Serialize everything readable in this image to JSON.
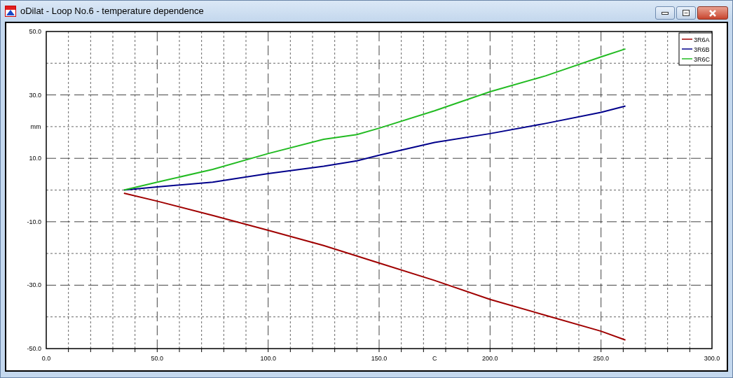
{
  "window": {
    "title": "oDilat - Loop No.6 - temperature dependence"
  },
  "chart": {
    "chart_data": {
      "type": "line",
      "xlabel": "C",
      "ylabel": "mm",
      "x": [
        35,
        50,
        75,
        100,
        125,
        140,
        150,
        175,
        200,
        225,
        250,
        261
      ],
      "series": [
        {
          "name": "3R6A",
          "color": "#a00000",
          "values": [
            -1,
            -3.5,
            -8,
            -12.7,
            -17.5,
            -20.8,
            -23,
            -28.5,
            -34.5,
            -39.5,
            -44.5,
            -47.3
          ]
        },
        {
          "name": "3R6B",
          "color": "#00008b",
          "values": [
            0,
            1,
            2.5,
            5.2,
            7.5,
            9.2,
            11,
            15,
            17.8,
            21,
            24.5,
            26.5
          ]
        },
        {
          "name": "3R6C",
          "color": "#22bb22",
          "values": [
            0,
            2.5,
            6.5,
            11.5,
            16,
            17.5,
            19.5,
            25,
            31,
            36,
            42,
            44.5
          ]
        }
      ],
      "grid": true,
      "legend": true,
      "xlim": [
        0,
        300
      ],
      "ylim": [
        -50,
        50
      ],
      "xticks": [
        {
          "value": 0,
          "label": "0.0"
        },
        {
          "value": 50,
          "label": "50.0"
        },
        {
          "value": 100,
          "label": "100.0"
        },
        {
          "value": 150,
          "label": "150.0"
        },
        {
          "value": 200,
          "label": "200.0"
        },
        {
          "value": 250,
          "label": "250.0"
        },
        {
          "value": 300,
          "label": "300.0"
        }
      ],
      "yticks": [
        {
          "value": 50,
          "label": "50.0"
        },
        {
          "value": 30,
          "label": "30.0"
        },
        {
          "value": 10,
          "label": "10.0"
        },
        {
          "value": -10,
          "label": "-10.0"
        },
        {
          "value": -30,
          "label": "-30.0"
        },
        {
          "value": -50,
          "label": "-50.0"
        }
      ]
    }
  }
}
